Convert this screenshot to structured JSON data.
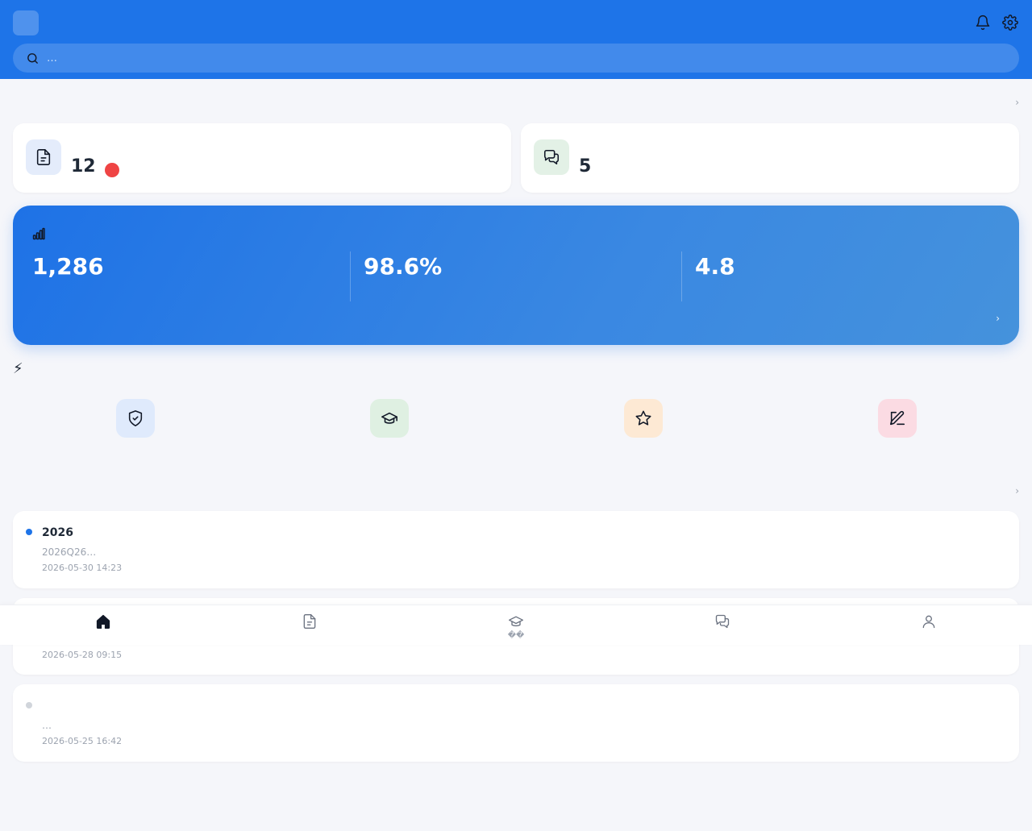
{
  "header": {
    "logo_glyph": "",
    "title": "",
    "search_placeholder": "…",
    "notification_icon": "bell-icon",
    "settings_icon": "gear-icon",
    "brand_color": "#1e74e8"
  },
  "todo": {
    "title": " ",
    "more": " ›",
    "cards": [
      {
        "label": "",
        "count": "12",
        "badge": "",
        "icon": "document-icon"
      },
      {
        "label": "",
        "count": "5",
        "icon": "chat-icon"
      }
    ]
  },
  "stats": {
    "title": "",
    "icon": "signal-bars-icon",
    "items": [
      {
        "value": "1,286",
        "label": ""
      },
      {
        "value": "98.6%",
        "label": ""
      },
      {
        "value": "4.8",
        "label": ""
      }
    ],
    "more": " ›"
  },
  "quick": {
    "title": "⚡ ",
    "items": [
      {
        "label": "",
        "icon": "shield-check-icon",
        "bg": "#dfeafc"
      },
      {
        "label": "",
        "icon": "graduation-cap-icon",
        "bg": "#dff0e2"
      },
      {
        "label": "",
        "icon": "star-icon",
        "bg": "#fde9d4"
      },
      {
        "label": "",
        "icon": "pencil-icon",
        "bg": "#fbdbe3"
      }
    ]
  },
  "notices": {
    "title": " ",
    "more": " ›",
    "items": [
      {
        "title": " 2026",
        "desc": "2026Q26…",
        "time": "2026-05-30 14:23",
        "unread": true
      },
      {
        "title": "",
        "desc": "",
        "time": "2026-05-28 09:15",
        "unread": true
      },
      {
        "title": " ",
        "desc": "…",
        "time": "2026-05-25 16:42",
        "unread": false
      }
    ]
  },
  "tabbar": {
    "active": 0,
    "items": [
      {
        "label": "",
        "icon": "home-icon"
      },
      {
        "label": "",
        "icon": "document-icon"
      },
      {
        "label": "��",
        "icon": "graduation-cap-icon"
      },
      {
        "label": "",
        "icon": "chat-icon"
      },
      {
        "label": "",
        "icon": "user-icon"
      }
    ]
  }
}
